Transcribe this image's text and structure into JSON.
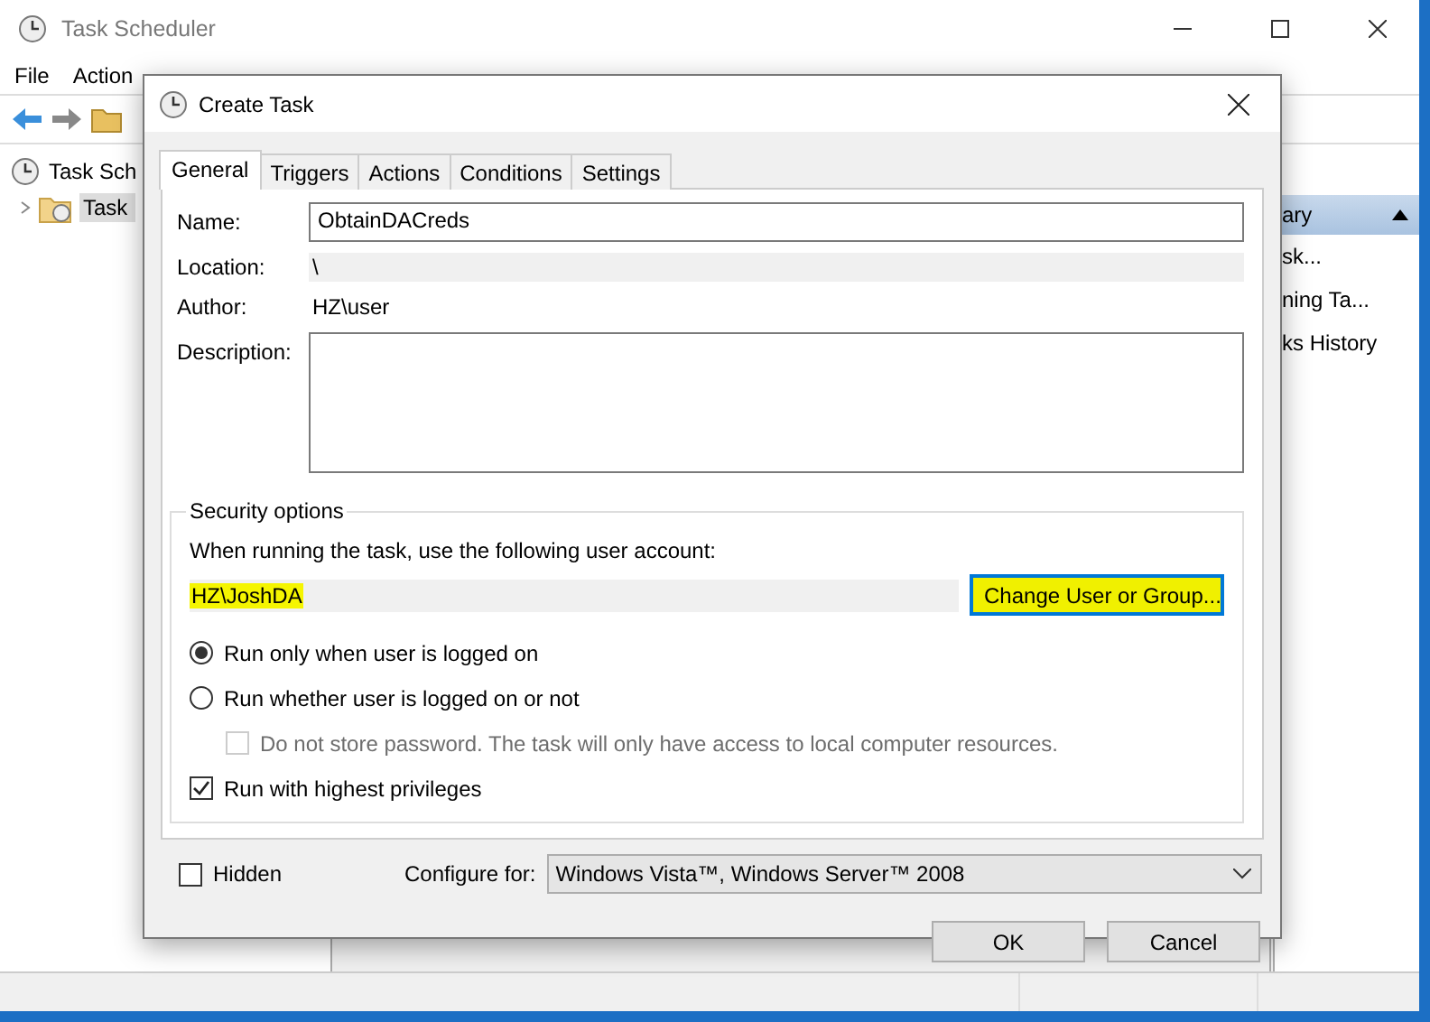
{
  "main_window": {
    "title": "Task Scheduler",
    "menu": [
      "File",
      "Action"
    ],
    "tree": [
      {
        "label": "Task Sch",
        "children": [
          {
            "label": "Task",
            "selected": true,
            "expanded": false
          }
        ]
      }
    ],
    "actions_pane": {
      "header": "ary",
      "items": [
        "sk...",
        "ning Ta...",
        "ks History"
      ]
    }
  },
  "dialog": {
    "title": "Create Task",
    "tabs": [
      {
        "label": "General",
        "selected": true
      },
      {
        "label": "Triggers",
        "selected": false
      },
      {
        "label": "Actions",
        "selected": false
      },
      {
        "label": "Conditions",
        "selected": false
      },
      {
        "label": "Settings",
        "selected": false
      }
    ],
    "name": {
      "label": "Name:",
      "value": "ObtainDACreds"
    },
    "location": {
      "label": "Location:",
      "value": "\\"
    },
    "author": {
      "label": "Author:",
      "value": "HZ\\user"
    },
    "description": {
      "label": "Description:"
    },
    "security": {
      "heading": "Security options",
      "prompt": "When running the task, use the following user account:",
      "account": "HZ\\JoshDA",
      "account_highlighted": true,
      "change_button": {
        "label": "Change User or Group...",
        "highlighted": true
      },
      "options": [
        {
          "kind": "radio",
          "label": "Run only when user is logged on",
          "selected": true,
          "disabled": false,
          "indent": false
        },
        {
          "kind": "radio",
          "label": "Run whether user is logged on or not",
          "selected": false,
          "disabled": false,
          "indent": false
        },
        {
          "kind": "checkbox",
          "label": "Do not store password.  The task will only have access to local computer resources.",
          "checked": false,
          "disabled": true,
          "indent": true
        },
        {
          "kind": "checkbox",
          "label": "Run with highest privileges",
          "checked": true,
          "disabled": false,
          "indent": false
        }
      ]
    },
    "hidden": {
      "label": "Hidden",
      "checked": false
    },
    "configure": {
      "label": "Configure for:",
      "value": "Windows Vista™, Windows Server™ 2008"
    },
    "buttons": [
      "OK",
      "Cancel"
    ]
  }
}
